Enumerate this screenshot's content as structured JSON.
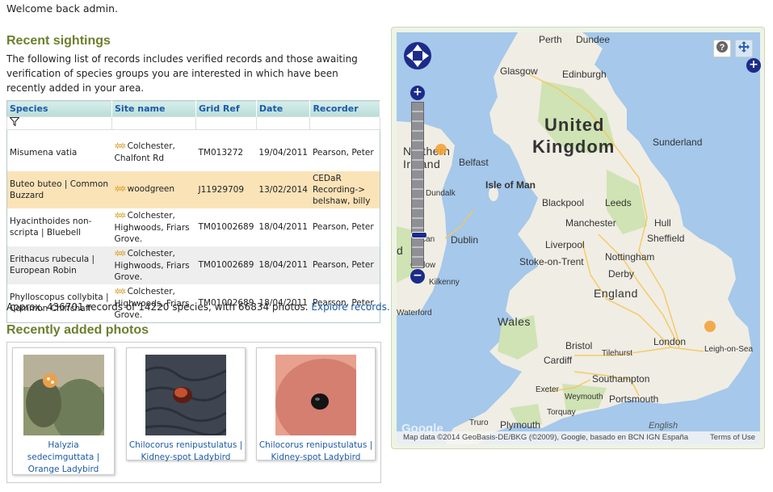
{
  "welcome": "Welcome back admin.",
  "recent_sightings": {
    "title": "Recent sightings",
    "intro": "The following list of records includes verified records and those awaiting verification of species groups you are interested in which have been recently added in your area.",
    "columns": [
      "Species",
      "Site name",
      "Grid Ref",
      "Date",
      "Recorder"
    ],
    "filter_icon": "filter-icon",
    "rows": [
      {
        "species": "Misumena vatia",
        "site": "Colchester, Chalfont Rd",
        "grid": "TM013272",
        "date": "19/04/2011",
        "recorder": "Pearson, Peter"
      },
      {
        "species": "Buteo buteo | Common Buzzard",
        "site": "woodgreen",
        "grid": "J11929709",
        "date": "13/02/2014",
        "recorder": "CEDaR Recording-> belshaw, billy"
      },
      {
        "species": "Hyacinthoides non-scripta | Bluebell",
        "site": "Colchester, Highwoods, Friars Grove.",
        "grid": "TM01002689",
        "date": "18/04/2011",
        "recorder": "Pearson, Peter"
      },
      {
        "species": "Erithacus rubecula | European Robin",
        "site": "Colchester, Highwoods, Friars Grove.",
        "grid": "TM01002689",
        "date": "18/04/2011",
        "recorder": "Pearson, Peter"
      },
      {
        "species": "Phylloscopus collybita | Common Chiffchaff",
        "site": "Colchester, Highwoods, Friars Grove.",
        "grid": "TM01002689",
        "date": "18/04/2011",
        "recorder": "Pearson, Peter"
      }
    ],
    "summary": "Approx. 436701 records of 14220 species, with 66834 photos.",
    "explore_link": "Explore records..."
  },
  "recent_photos": {
    "title": "Recently added photos",
    "photos": [
      {
        "caption": "Halyzia sedecimguttata | Orange Ladybird"
      },
      {
        "caption": "Chilocorus renipustulatus | Kidney-spot Ladybird"
      },
      {
        "caption": "Chilocorus renipustulatus | Kidney-spot Ladybird"
      }
    ]
  },
  "map": {
    "labels": {
      "perth": "Perth",
      "dundee": "Dundee",
      "glasgow": "Glasgow",
      "edinburgh": "Edinburgh",
      "united": "United",
      "kingdom": "Kingdom",
      "northern": "Northern",
      "ireland": "Ireland",
      "belfast": "Belfast",
      "isle_of_man": "Isle of Man",
      "sunderland": "Sunderland",
      "dundalk": "Dundalk",
      "blackpool": "Blackpool",
      "leeds": "Leeds",
      "manchester": "Manchester",
      "hull": "Hull",
      "sheffield": "Sheffield",
      "liverpool": "Liverpool",
      "lucan": "Lucan",
      "dublin": "Dublin",
      "stoke": "Stoke-on-Trent",
      "nottingham": "Nottingham",
      "derby": "Derby",
      "carlow": "Carlow",
      "kilkenny": "Kilkenny",
      "england": "England",
      "ireland_partial": "d",
      "waterford": "Waterford",
      "wales": "Wales",
      "bristol": "Bristol",
      "london": "London",
      "cardiff": "Cardiff",
      "tilehurst": "Tilehurst",
      "leigh": "Leigh-on-Sea",
      "southampton": "Southampton",
      "exeter": "Exeter",
      "weymouth": "Weymouth",
      "portsmouth": "Portsmouth",
      "torquay": "Torquay",
      "truro": "Truro",
      "plymouth": "Plymouth",
      "english": "English",
      "google": "Google"
    },
    "attribution": "Map data ©2014 GeoBasis-DE/BKG (©2009), Google, basado en BCN IGN España",
    "terms": "Terms of Use",
    "help_icon": "question-icon",
    "move_icon": "move-arrows-icon",
    "layer_switcher_label": "+",
    "zoom_in_label": "+",
    "zoom_out_label": "−",
    "colors": {
      "sea": "#a5c8eb",
      "land": "#f0ede4",
      "green": "#cfe3b4",
      "marker": "#f2a23a"
    }
  }
}
